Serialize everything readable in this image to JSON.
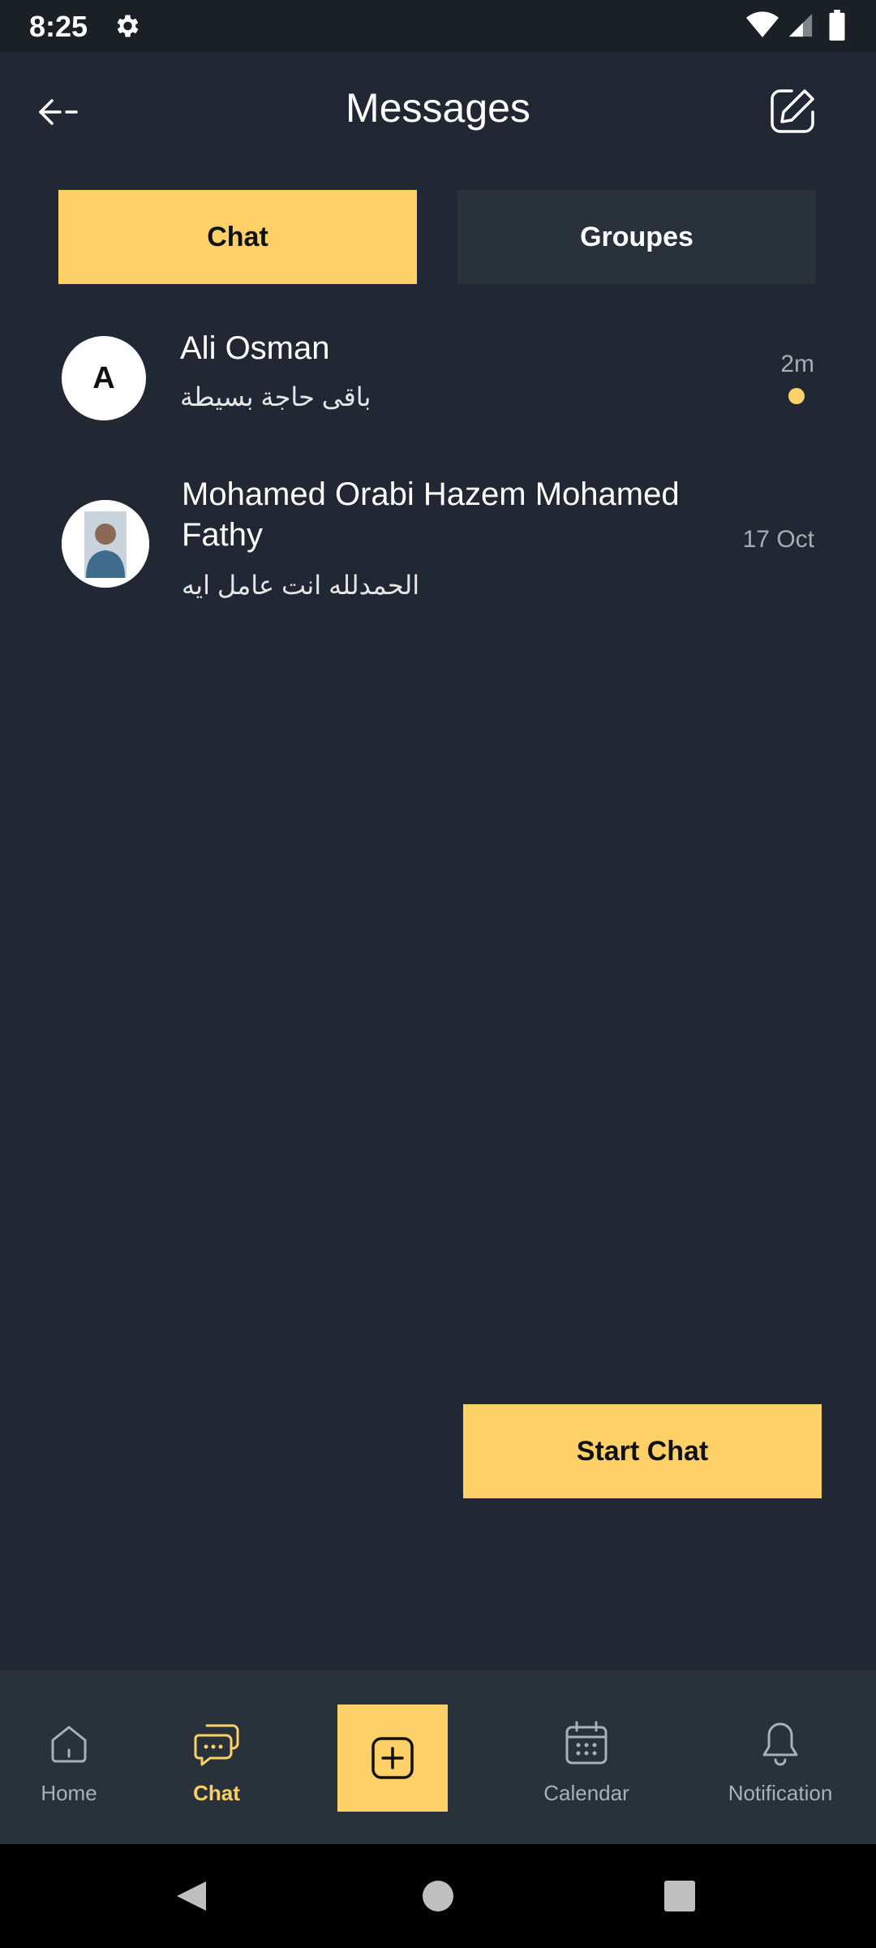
{
  "status_bar": {
    "time": "8:25"
  },
  "header": {
    "title": "Messages"
  },
  "tabs": [
    {
      "label": "Chat",
      "active": true
    },
    {
      "label": "Groupes",
      "active": false
    }
  ],
  "conversations": [
    {
      "avatar_initial": "A",
      "name": "Ali Osman",
      "last_message": "باقى حاجة بسيطة",
      "time": "2m",
      "unread": true
    },
    {
      "avatar_initial": "",
      "name": "Mohamed Orabi Hazem Mohamed Fathy",
      "last_message": "الحمدلله انت عامل ايه",
      "time": "17 Oct",
      "unread": false
    }
  ],
  "start_chat_label": "Start Chat",
  "bottom_nav": [
    {
      "label": "Home",
      "icon": "home-icon",
      "active": false
    },
    {
      "label": "Chat",
      "icon": "chat-icon",
      "active": true
    },
    {
      "label": "",
      "icon": "add-square-icon",
      "active": false
    },
    {
      "label": "Calendar",
      "icon": "calendar-icon",
      "active": false
    },
    {
      "label": "Notification",
      "icon": "bell-icon",
      "active": false
    }
  ],
  "colors": {
    "background": "#222833",
    "accent": "#fdd168",
    "panel": "#29313a"
  }
}
